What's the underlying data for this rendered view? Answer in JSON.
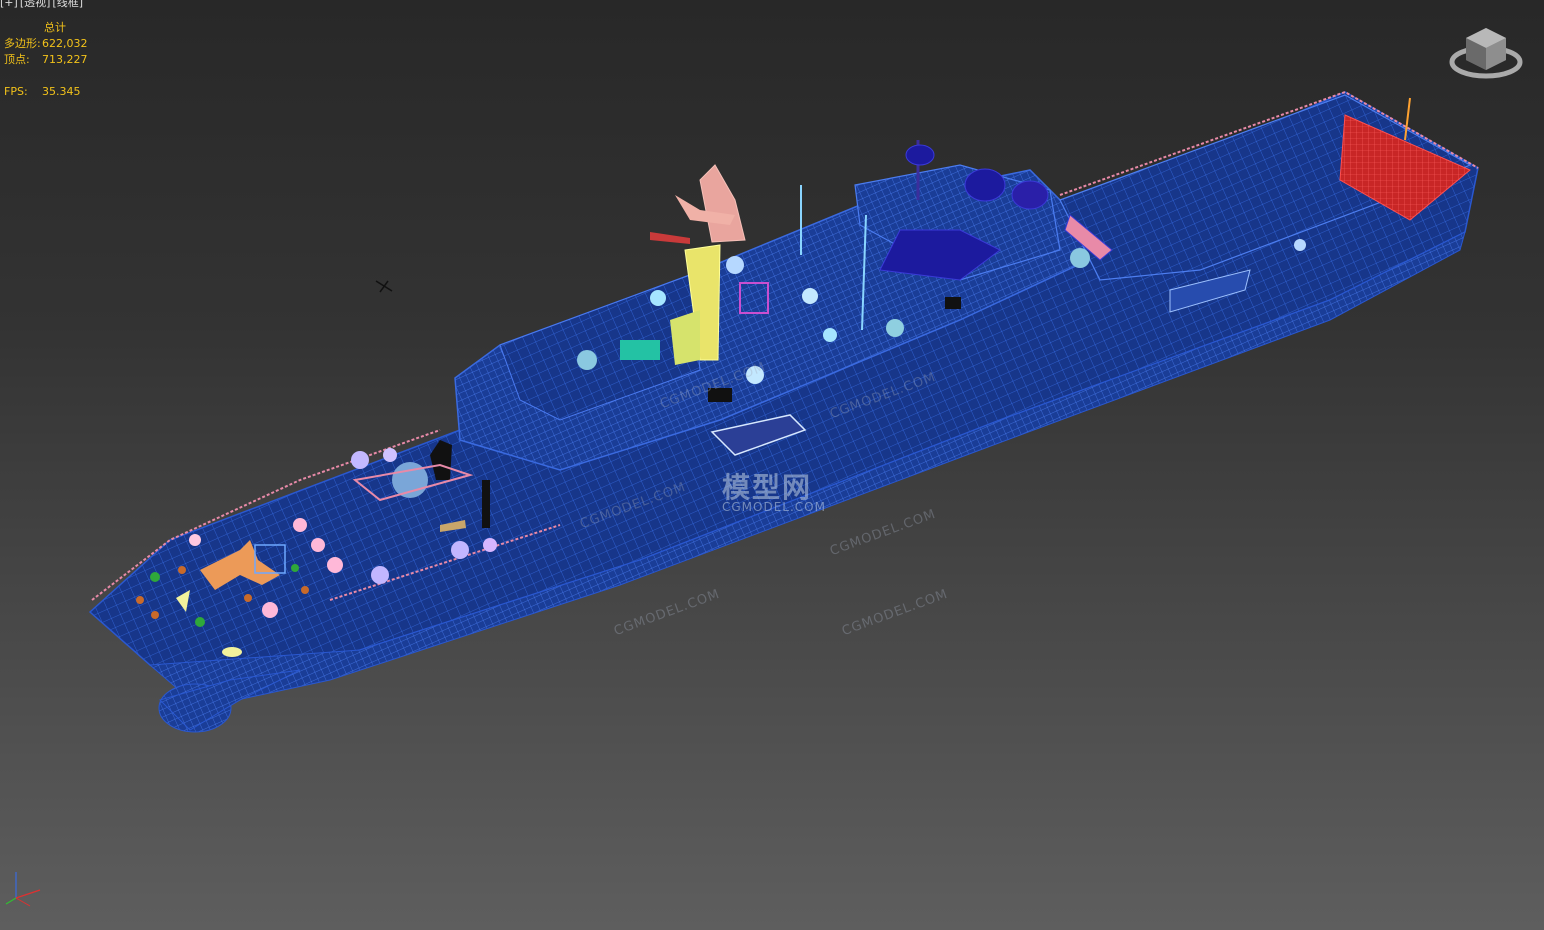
{
  "viewport": {
    "labels": [
      "[+]",
      "[透视]",
      "[线框]"
    ],
    "stats": {
      "title": "总计",
      "polygons_label": "多边形:",
      "polygons_value": "622,032",
      "vertices_label": "顶点:",
      "vertices_value": "713,227",
      "fps_label": "FPS:",
      "fps_value": "35.345"
    },
    "watermark": {
      "main": "模型网",
      "sub": "CGMODEL.COM",
      "diagonal": [
        "CGMODEL.COM",
        "CGMODEL.COM",
        "CGMODEL.COM",
        "CGMODEL.COM",
        "CGMODEL.COM",
        "CGMODEL.COM"
      ]
    },
    "colors": {
      "stats_text": "#f2c21a",
      "hull_wire": "#1e4fb8",
      "railing": "#e88aa8",
      "mast": "#e9e46a",
      "red_panel": "#e03030"
    },
    "icons": [
      "viewcube-icon",
      "axis-tripod-icon",
      "cursor-cross-icon"
    ]
  }
}
